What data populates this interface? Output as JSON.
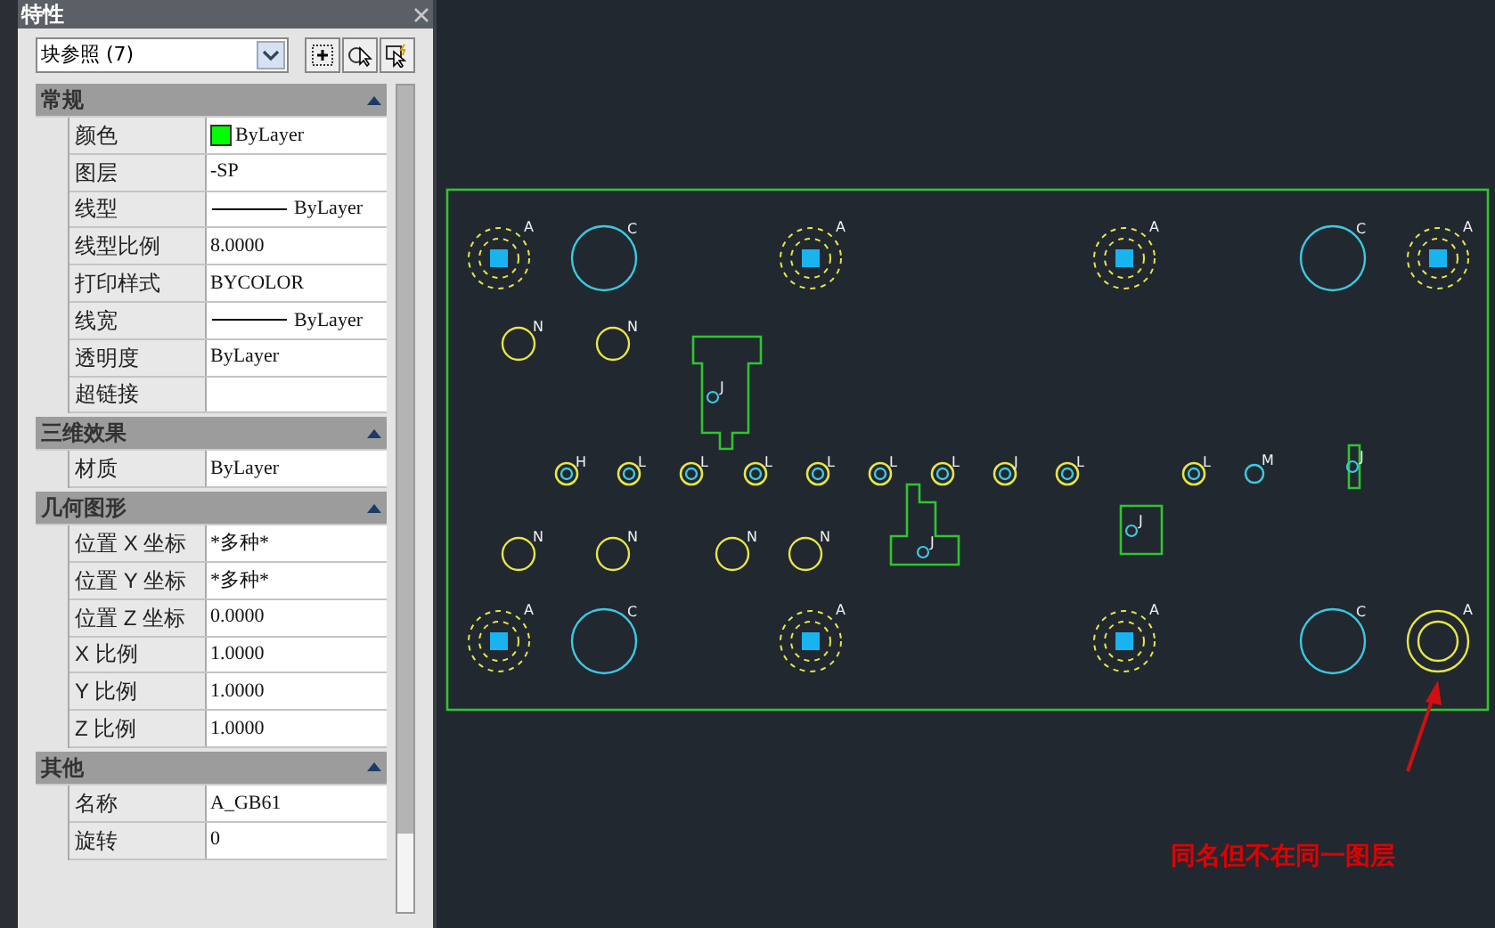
{
  "panel": {
    "title": "特性",
    "selector": {
      "value": "块参照 (7)"
    },
    "sections": [
      {
        "title": "常规",
        "expanded": true,
        "rows": [
          {
            "label": "颜色",
            "value": "ByLayer",
            "kind": "color",
            "color": "#00ff00"
          },
          {
            "label": "图层",
            "value": "-SP",
            "kind": "text"
          },
          {
            "label": "线型",
            "value": "ByLayer",
            "kind": "line"
          },
          {
            "label": "线型比例",
            "value": "8.0000",
            "kind": "text"
          },
          {
            "label": "打印样式",
            "value": "BYCOLOR",
            "kind": "text"
          },
          {
            "label": "线宽",
            "value": "ByLayer",
            "kind": "line"
          },
          {
            "label": "透明度",
            "value": "ByLayer",
            "kind": "text"
          },
          {
            "label": "超链接",
            "kind": "text"
          }
        ]
      },
      {
        "title": "三维效果",
        "expanded": true,
        "rows": [
          {
            "label": "材质",
            "value": "ByLayer",
            "kind": "text"
          }
        ]
      },
      {
        "title": "几何图形",
        "expanded": true,
        "rows": [
          {
            "label": "位置 X 坐标",
            "value": "*多种*",
            "kind": "text"
          },
          {
            "label": "位置 Y 坐标",
            "value": "*多种*",
            "kind": "text"
          },
          {
            "label": "位置 Z 坐标",
            "value": "0.0000",
            "kind": "text"
          },
          {
            "label": "X 比例",
            "value": "1.0000",
            "kind": "text"
          },
          {
            "label": "Y 比例",
            "value": "1.0000",
            "kind": "text"
          },
          {
            "label": "Z 比例",
            "value": "1.0000",
            "kind": "text"
          }
        ]
      },
      {
        "title": "其他",
        "expanded": true,
        "rows": [
          {
            "label": "名称",
            "value": "A_GB61",
            "kind": "text"
          },
          {
            "label": "旋转",
            "value": "0",
            "kind": "text"
          }
        ]
      }
    ]
  },
  "drawing": {
    "items": [
      {
        "kind": "mount",
        "label": "A"
      },
      {
        "kind": "hole",
        "label": "C"
      },
      {
        "kind": "mount",
        "label": "A"
      },
      {
        "kind": "mount",
        "label": "A"
      },
      {
        "kind": "hole",
        "label": "C"
      },
      {
        "kind": "mount",
        "label": "A"
      },
      {
        "kind": "small_hole",
        "label": "N"
      },
      {
        "kind": "small_hole",
        "label": "N"
      },
      {
        "kind": "part",
        "label": "J"
      },
      {
        "kind": "pin",
        "label": "H"
      },
      {
        "kind": "pin",
        "label": "L"
      },
      {
        "kind": "pin",
        "label": "L"
      },
      {
        "kind": "pin",
        "label": "L"
      },
      {
        "kind": "pin",
        "label": "L"
      },
      {
        "kind": "pin",
        "label": "L"
      },
      {
        "kind": "pin",
        "label": "L"
      },
      {
        "kind": "pin",
        "label": "J"
      },
      {
        "kind": "pin",
        "label": "L"
      },
      {
        "kind": "pin",
        "label": "L"
      },
      {
        "kind": "marker",
        "label": "M"
      },
      {
        "kind": "part",
        "label": "J"
      },
      {
        "kind": "part",
        "label": "J"
      },
      {
        "kind": "part",
        "label": "J"
      },
      {
        "kind": "small_hole",
        "label": "N"
      },
      {
        "kind": "small_hole",
        "label": "N"
      },
      {
        "kind": "small_hole",
        "label": "N"
      },
      {
        "kind": "small_hole",
        "label": "N"
      },
      {
        "kind": "mount",
        "label": "A"
      },
      {
        "kind": "hole",
        "label": "C"
      },
      {
        "kind": "mount",
        "label": "A"
      },
      {
        "kind": "mount",
        "label": "A"
      },
      {
        "kind": "hole",
        "label": "C"
      },
      {
        "kind": "plain_mount",
        "label": "A"
      }
    ],
    "annotation": {
      "text": "同名但不在同一图层"
    }
  }
}
